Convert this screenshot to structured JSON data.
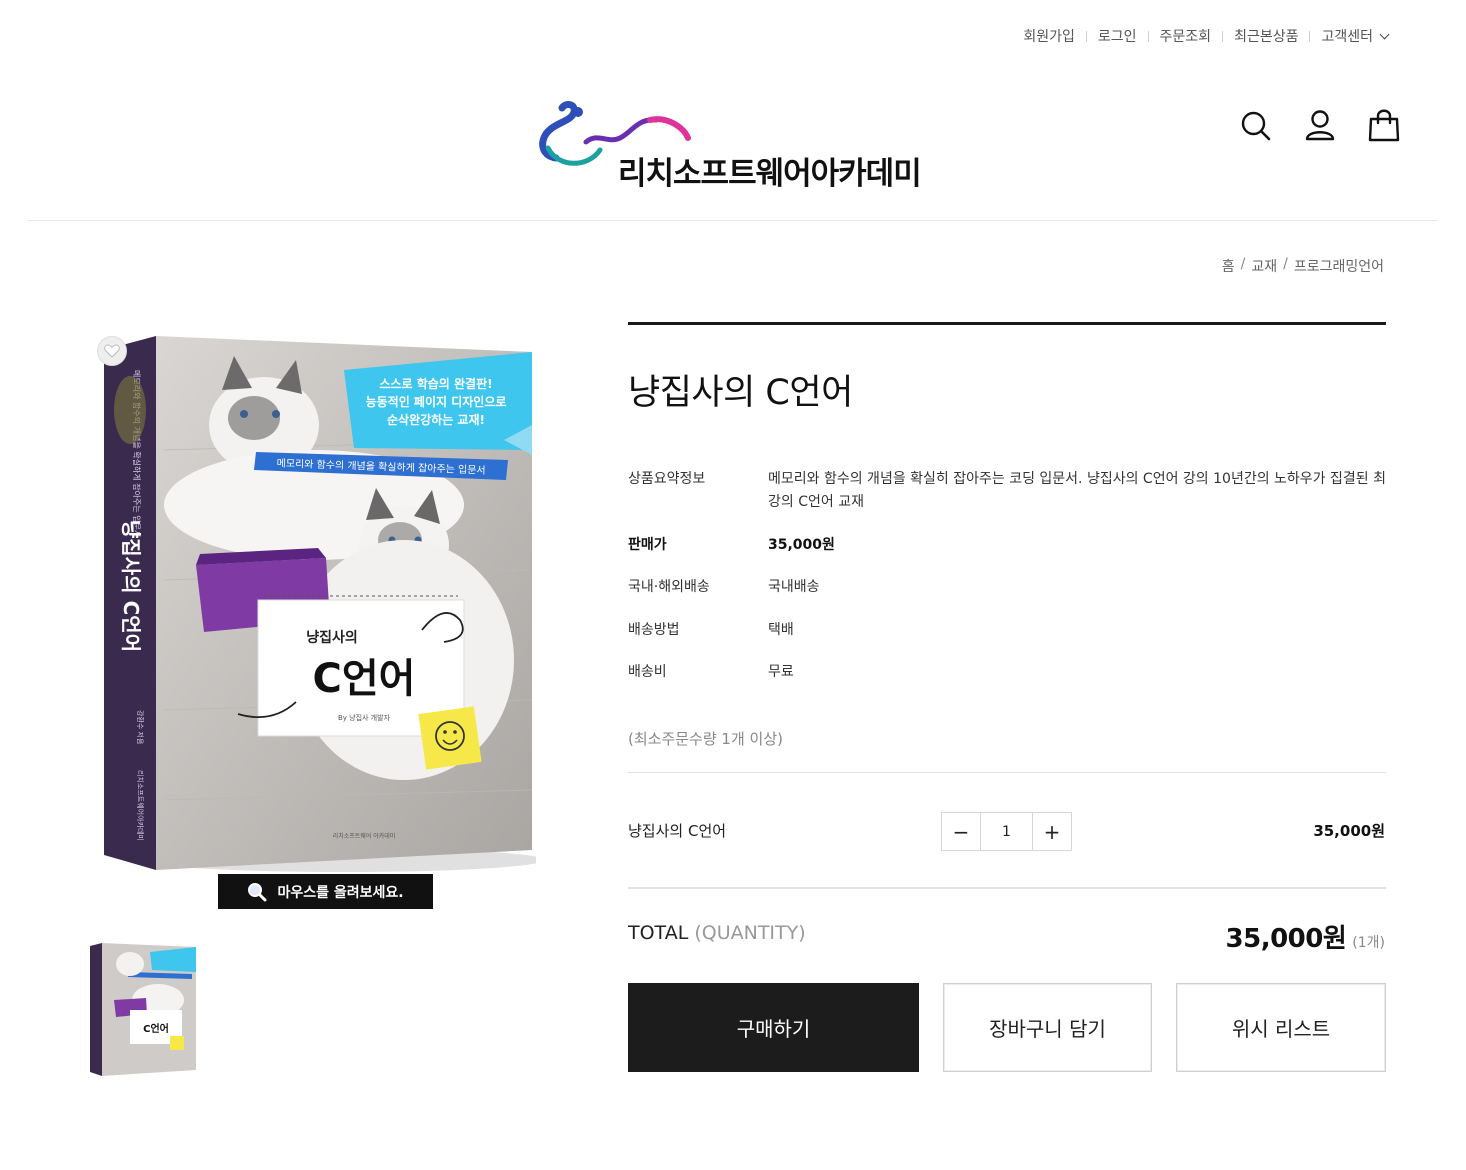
{
  "util_nav": {
    "items": [
      "회원가입",
      "로그인",
      "주문조회",
      "최근본상품",
      "고객센터"
    ]
  },
  "logo": {
    "text": "리치소프트웨어아카데미"
  },
  "header_icons": [
    "search-icon",
    "user-icon",
    "shopping-bag-icon"
  ],
  "breadcrumb": {
    "items": [
      "홈",
      "교재",
      "프로그래밍언어"
    ]
  },
  "product": {
    "title": "냥집사의 C언어",
    "image": {
      "spine_top": "메모리와 함수의 개념을 확실하게 잡아주는 입문서",
      "spine_title": "냥집사의 C언어",
      "spine_author": "강환수 저음",
      "spine_publisher": "리치소프트웨어아카데미",
      "banner_lines": [
        "스스로 학습의 완결판!",
        "능동적인 페이지 디자인으로",
        "순삭완강하는 교재!"
      ],
      "tagline": "메모리와 함수의 개념을 확실하게 잡아주는 입문서",
      "card_small": "냥집사의",
      "card_big": "C언어",
      "card_by": "By 냥집사 개발자",
      "publisher_bottom": "리치소프트웨어 아카데미",
      "zoom_text": "마우스를 올려보세요."
    },
    "specs": {
      "summary_label": "상품요약정보",
      "summary_value": "메모리와 함수의 개념을 확실히 잡아주는 코딩 입문서. 냥집사의 C언어 강의 10년간의 노하우가 집결된 최강의 C언어 교재",
      "price_label": "판매가",
      "price_value": "35,000원",
      "shipping_scope_label": "국내·해외배송",
      "shipping_scope_value": "국내배송",
      "shipping_method_label": "배송방법",
      "shipping_method_value": "택배",
      "shipping_fee_label": "배송비",
      "shipping_fee_value": "무료"
    },
    "min_order": "(최소주문수량 1개 이상)",
    "option": {
      "name": "냥집사의 C언어",
      "quantity": "1",
      "minus": "−",
      "plus": "+",
      "price": "35,000원"
    },
    "total": {
      "label": "TOTAL",
      "sub": "(QUANTITY)",
      "amount": "35,000원",
      "count": "(1개)"
    },
    "buttons": {
      "buy": "구매하기",
      "cart": "장바구니 담기",
      "wish": "위시 리스트"
    }
  },
  "colors": {
    "primary_button": "#1c1c1c",
    "divider": "#e3e3e3",
    "banner_blue": "#3ec6ee",
    "book_purple": "#3a2a4d"
  }
}
